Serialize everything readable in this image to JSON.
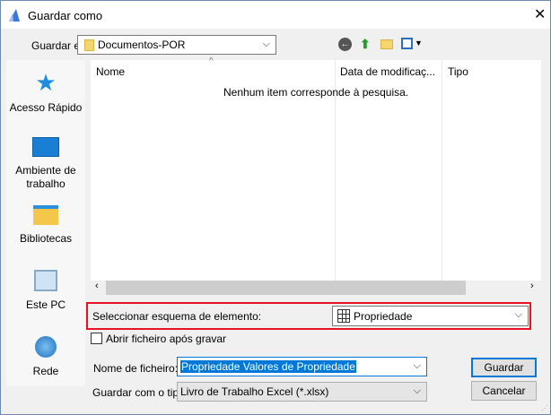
{
  "title": "Guardar como",
  "save_in": {
    "label": "Guardar em:",
    "value": "Documentos-POR"
  },
  "toolbar": {
    "back": "back-icon",
    "up": "up-folder-icon",
    "new_folder": "new-folder-icon",
    "view": "view-menu-icon"
  },
  "sidebar": {
    "items": [
      {
        "label": "Acesso Rápido"
      },
      {
        "label": "Ambiente de trabalho"
      },
      {
        "label": "Bibliotecas"
      },
      {
        "label": "Este PC"
      },
      {
        "label": "Rede"
      }
    ]
  },
  "list": {
    "columns": [
      "Nome",
      "Data de modificaç...",
      "Tipo"
    ],
    "empty": "Nenhum item corresponde à pesquisa."
  },
  "schema": {
    "label": "Seleccionar esquema de elemento:",
    "value": "Propriedade"
  },
  "open_after": {
    "label": "Abrir ficheiro após gravar",
    "checked": false
  },
  "filename": {
    "label": "Nome de ficheiro:",
    "value": "Propriedade Valores de Propriedade"
  },
  "filetype": {
    "label": "Guardar com o tipo:",
    "value": "Livro de Trabalho Excel (*.xlsx)"
  },
  "buttons": {
    "save": "Guardar",
    "cancel": "Cancelar"
  },
  "colors": {
    "highlight": "#e81123",
    "selection": "#0078d7"
  }
}
